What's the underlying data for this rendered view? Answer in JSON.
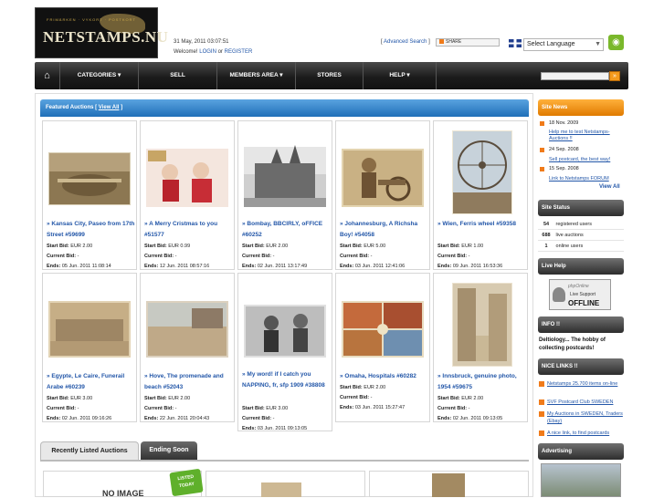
{
  "header": {
    "logo_small": "FRIMÄRKEN · VYKORT · POSTKORT",
    "logo_brand": "NETSTAMPS.NU",
    "date": "31 May, 2011 03:07:51",
    "welcome": "Welcome!",
    "login": "LOGIN",
    "or": "or",
    "register": "REGISTER",
    "advanced_search_open": "[",
    "advanced_search": "Advanced Search",
    "advanced_search_close": "]",
    "share": "SHARE",
    "language": "Select Language"
  },
  "nav": {
    "items": [
      "CATEGORIES",
      "SELL",
      "MEMBERS AREA",
      "STORES",
      "HELP"
    ]
  },
  "featured": {
    "title": "Featured Auctions",
    "view_all": "View All",
    "labels": {
      "start": "Start Bid:",
      "current": "Current Bid:",
      "ends": "Ends:"
    },
    "cards": [
      {
        "title": "» Kansas City, Paseo from 17th Street #59699",
        "start": "EUR 2.00",
        "current": "-",
        "ends": "05 Jun. 2011 11:08:14"
      },
      {
        "title": "» A Merry Cristmas to you #51577",
        "start": "EUR 0.99",
        "current": "-",
        "ends": "12 Jun. 2011 08:57:16"
      },
      {
        "title": "» Bombay, BBCIRLY, oFFICE #60252",
        "start": "EUR 2.00",
        "current": "-",
        "ends": "02 Jun. 2011 13:17:49"
      },
      {
        "title": "» Johannesburg, A Richsha Boy! #54058",
        "start": "EUR 5.00",
        "current": "-",
        "ends": "03 Jun. 2011 12:41:06"
      },
      {
        "title": "» Wien, Ferris wheel #59358",
        "start": "EUR 1.00",
        "current": "-",
        "ends": "09 Jun. 2011 16:53:36"
      },
      {
        "title": "» Egypte, Le Caire, Funerail Arabe #60239",
        "start": "EUR 3.00",
        "current": "-",
        "ends": "02 Jun. 2011 09:16:26"
      },
      {
        "title": "» Hove, The promenade and beach #52043",
        "start": "EUR 2.00",
        "current": "-",
        "ends": "22 Jun. 2011 20:04:43"
      },
      {
        "title": "» My word! if I catch you NAPPING, fr, sfp 1909 #38808",
        "start": "EUR 3.00",
        "current": "-",
        "ends": "03 Jun. 2011 09:13:05"
      },
      {
        "title": "» Omaha, Hospitals #60282",
        "start": "EUR 2.00",
        "current": "-",
        "ends": "03 Jun. 2011 15:27:47"
      },
      {
        "title": "» Innsbruck, genuine photo, 1954 #59675",
        "start": "EUR 2.00",
        "current": "-",
        "ends": "02 Jun. 2011 09:13:05"
      }
    ]
  },
  "tabs": {
    "recent": "Recently Listed Auctions",
    "ending": "Ending Soon"
  },
  "bottom": {
    "noimage": "NO IMAGE",
    "badge": "LISTED TODAY"
  },
  "sidebar": {
    "site_news": "Site News",
    "news": [
      {
        "date": "18 Nov. 2009",
        "link": "Help me to test Netstamps-Auctions !!"
      },
      {
        "date": "24 Sep. 2008",
        "link": "Sell postcard, the best way!"
      },
      {
        "date": "15 Sep. 2008",
        "link": "Link to Netstamps FORUM"
      }
    ],
    "view_all": "View All",
    "site_status": "Site Status",
    "stats": [
      {
        "num": "54",
        "label": "registered users"
      },
      {
        "num": "688",
        "label": "live auctions"
      },
      {
        "num": "1",
        "label": "online users"
      }
    ],
    "live_help": "Live Help",
    "support_t1": "phpOnline",
    "support_t2": "Live Support",
    "support_t3": "OFFLINE",
    "info_title": "INFO !!",
    "info_text": "Deltiology... The hobby of collecting postcards!",
    "nice_links": "NICE LINKS !!",
    "links": [
      "Netstamps 25.700 items on-line",
      "SVF Postcard Club SWEDEN",
      "My Auctions in SWEDEN, Traders (Ebay)",
      "A nice link, to find postcards"
    ],
    "advertising": "Advertising"
  }
}
